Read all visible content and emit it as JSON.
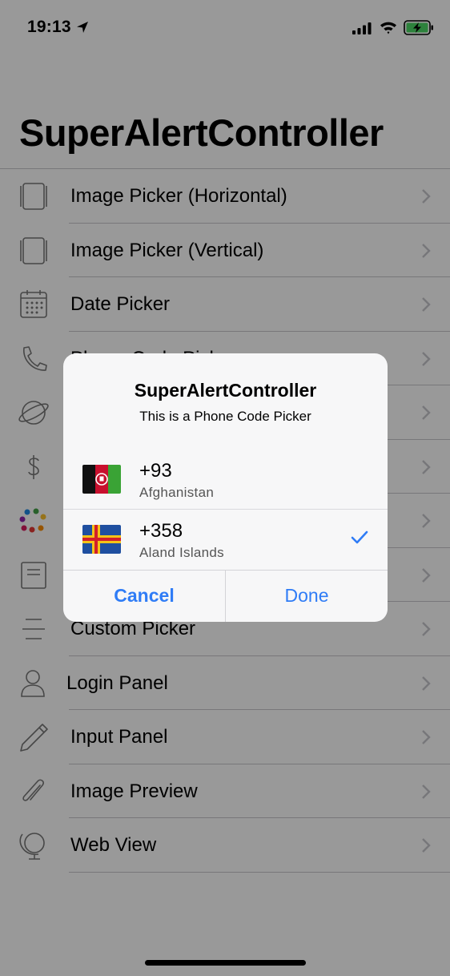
{
  "status_bar": {
    "time": "19:13"
  },
  "page": {
    "title": "SuperAlertController"
  },
  "list": {
    "items": [
      {
        "label": "Image Picker (Horizontal)",
        "icon": "image-picker-horizontal-icon"
      },
      {
        "label": "Image Picker (Vertical)",
        "icon": "image-picker-vertical-icon"
      },
      {
        "label": "Date Picker",
        "icon": "calendar-icon"
      },
      {
        "label": "Phone Code Picker",
        "icon": "phone-icon"
      },
      {
        "label": "",
        "icon": "planet-icon"
      },
      {
        "label": "",
        "icon": "dollar-icon"
      },
      {
        "label": "",
        "icon": "color-dots-icon"
      },
      {
        "label": "",
        "icon": "document-icon"
      },
      {
        "label": "Custom Picker",
        "icon": "lines-icon"
      },
      {
        "label": "Login Panel",
        "icon": "person-icon"
      },
      {
        "label": "Input Panel",
        "icon": "pencil-icon"
      },
      {
        "label": "Image Preview",
        "icon": "paperclip-icon"
      },
      {
        "label": "Web View",
        "icon": "globe-icon"
      }
    ]
  },
  "alert": {
    "title": "SuperAlertController",
    "message": "This is a Phone Code Picker",
    "options": [
      {
        "code": "+93",
        "country": "Afghanistan",
        "flag": "afghanistan-flag",
        "selected": false
      },
      {
        "code": "+358",
        "country": "Aland Islands",
        "flag": "aland-islands-flag",
        "selected": true
      }
    ],
    "cancel_label": "Cancel",
    "done_label": "Done"
  },
  "colors": {
    "accent": "#2f7cf6",
    "overlay": "rgba(0,0,0,0.40)",
    "separator": "#c8c7cc",
    "battery": "#4cd964"
  }
}
